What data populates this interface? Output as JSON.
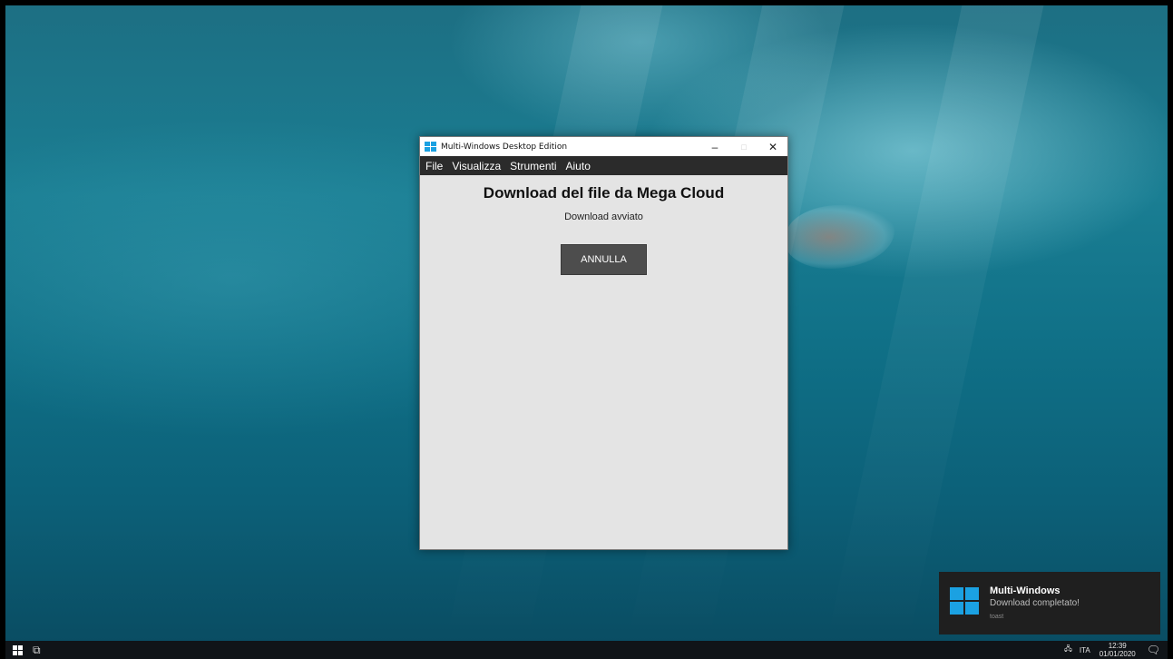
{
  "window": {
    "title": "Multi-Windows Desktop Edition",
    "minimize": "–",
    "maximize": "□",
    "close": "✕"
  },
  "menu": [
    "File",
    "Visualizza",
    "Strumenti",
    "Aiuto"
  ],
  "content": {
    "heading": "Download del file da Mega Cloud",
    "status": "Download avviato",
    "cancel_label": "ANNULLA"
  },
  "toast": {
    "title": "Multi-Windows",
    "message": "Download completato!",
    "source": "toast"
  },
  "taskbar": {
    "language": "ITA",
    "time": "12:39",
    "date": "01/01/2020",
    "taskview_icon": "task-view-icon",
    "network_icon": "network-icon",
    "notification_icon": "notification-icon"
  },
  "colors": {
    "accent": "#1ba1e2",
    "menubar": "#2b2b2b",
    "button": "#4d4d4d",
    "window_bg": "#e4e4e4"
  }
}
